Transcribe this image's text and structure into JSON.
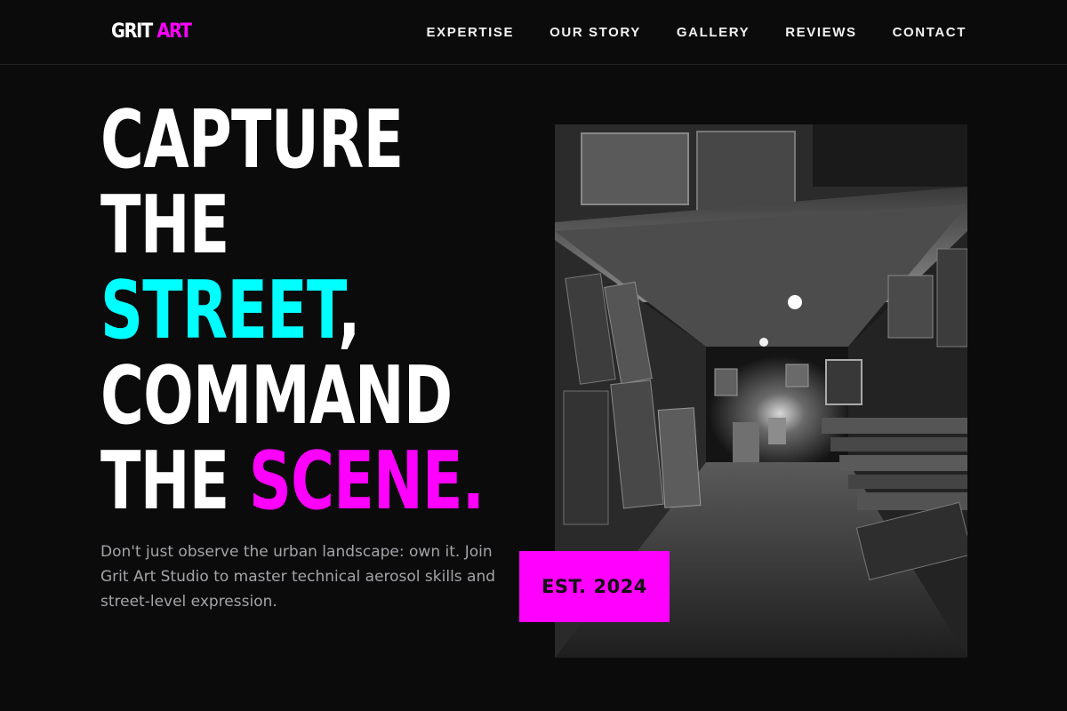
{
  "brand": {
    "part1": "GRIT",
    "part2": "ART"
  },
  "nav": {
    "items": [
      {
        "label": "EXPERTISE"
      },
      {
        "label": "OUR STORY"
      },
      {
        "label": "GALLERY"
      },
      {
        "label": "REVIEWS"
      },
      {
        "label": "CONTACT"
      }
    ]
  },
  "hero": {
    "line1": "CAPTURE",
    "line2": "THE",
    "line3_accent": "STREET",
    "line3_rest": ",",
    "line4": "COMMAND",
    "line5_plain": "THE ",
    "line5_accent": "SCENE.",
    "description": "Don't just observe the urban landscape: own it. Join Grit Art Studio to master technical aerosol skills and street-level expression.",
    "badge": "EST. 2024"
  },
  "colors": {
    "background": "#0b0b0c",
    "accent_cyan": "#00ffff",
    "accent_magenta": "#ff00ff",
    "text_muted": "#a4a4a8"
  }
}
